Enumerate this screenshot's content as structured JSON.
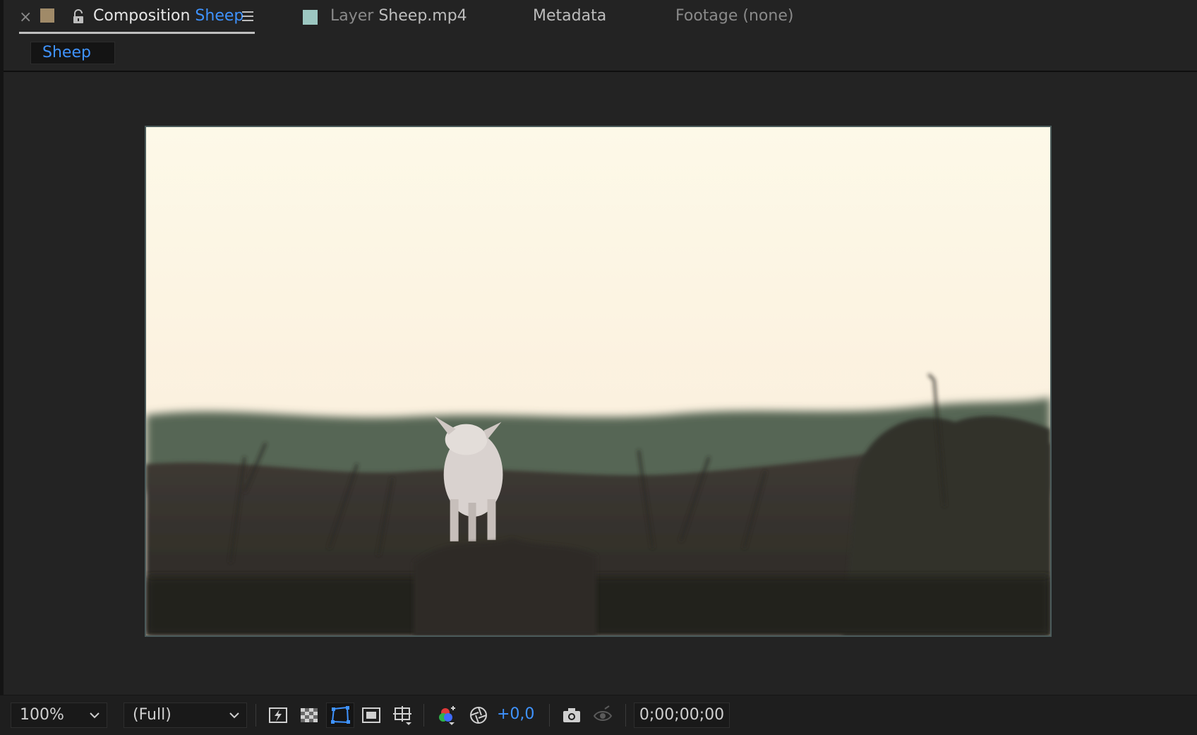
{
  "tabs": {
    "close_glyph": "×",
    "composition": {
      "prefix": "Composition",
      "name": "Sheep",
      "swatch_color": "#a08a68"
    },
    "layer": {
      "prefix": "Layer",
      "name": "Sheep.mp4",
      "swatch_color": "#9cc7c1"
    },
    "metadata": {
      "label": "Metadata"
    },
    "footage": {
      "label": "Footage (none)"
    }
  },
  "breadcrumb": {
    "label": "Sheep"
  },
  "viewer": {
    "scene": "lamb walking through heathland at dusk"
  },
  "toolbar": {
    "zoom": "100%",
    "resolution": "(Full)",
    "exposure": "+0,0",
    "timecode": "0;00;00;00",
    "icons": [
      "fast-previews-icon",
      "transparency-grid-icon",
      "mask-visibility-icon",
      "region-of-interest-icon",
      "grid-guides-icon",
      "channel-icon",
      "reset-exposure-icon",
      "snapshot-icon",
      "show-snapshot-icon"
    ]
  },
  "colors": {
    "accent": "#3f93ff",
    "panel": "#232323",
    "field": "#191919"
  }
}
